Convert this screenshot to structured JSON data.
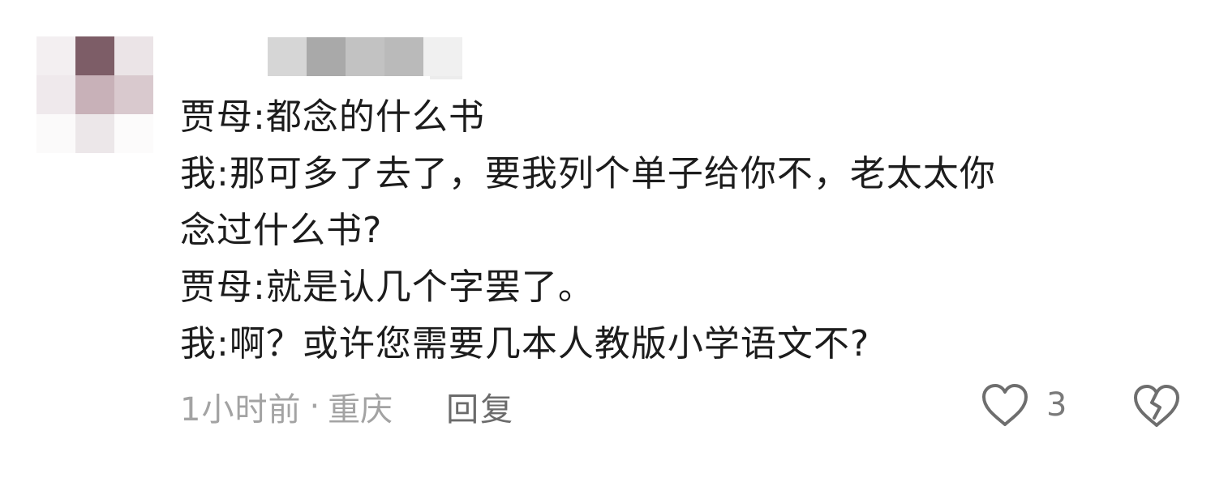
{
  "comment": {
    "lines": [
      "贾母:都念的什么书",
      "我:那可多了去了，要我列个单子给你不，老太太你",
      "念过什么书?",
      "贾母:就是认几个字罢了。",
      "我:啊？或许您需要几本人教版小学语文不?"
    ]
  },
  "meta": {
    "time": "1小时前",
    "separator": "·",
    "location": "重庆",
    "reply_label": "回复"
  },
  "actions": {
    "like_count": "3",
    "like_icon": "heart-outline-icon",
    "dislike_icon": "broken-heart-icon"
  },
  "colors": {
    "text": "#1c1c1c",
    "meta_text": "#a3a3a3",
    "reply_text": "#6b6b6b",
    "icon_stroke": "#6e6e6e"
  }
}
